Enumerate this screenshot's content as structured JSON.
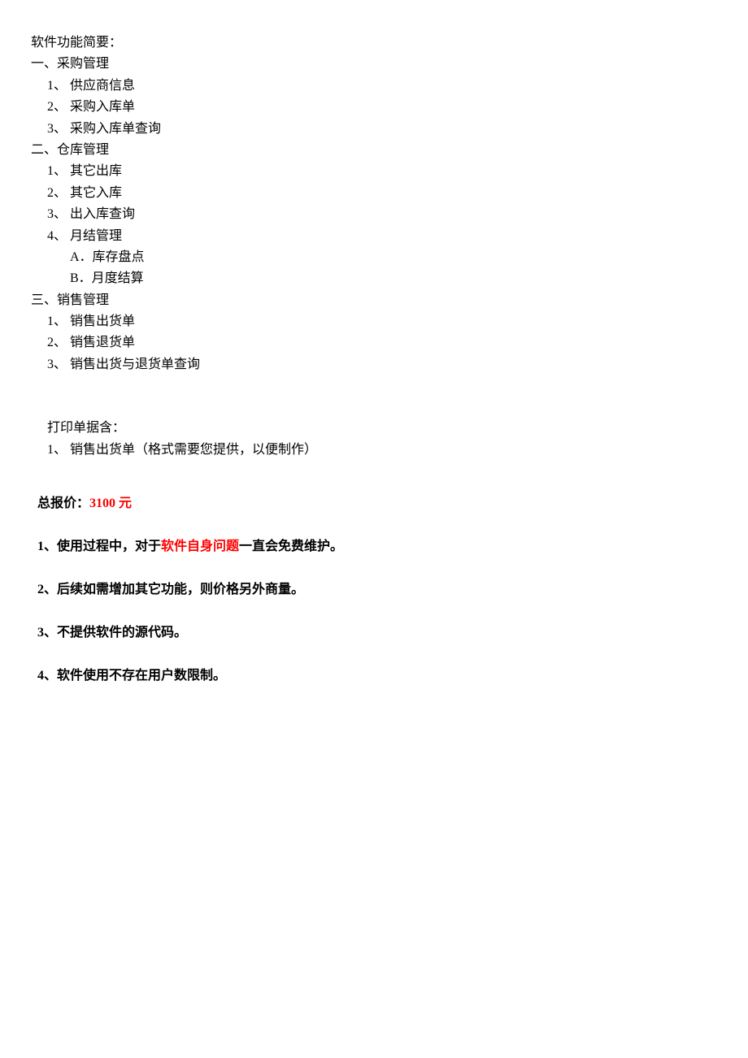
{
  "title": "软件功能简要：",
  "sections": [
    {
      "heading": "一、采购管理",
      "items": [
        "1、 供应商信息",
        "2、 采购入库单",
        "3、 采购入库单查询"
      ]
    },
    {
      "heading": "二、仓库管理",
      "items": [
        "1、 其它出库",
        "2、 其它入库",
        "3、 出入库查询",
        "4、 月结管理"
      ],
      "subitems": [
        "A．库存盘点",
        "B．月度结算"
      ]
    },
    {
      "heading": "三、销售管理",
      "items": [
        "1、 销售出货单",
        "2、 销售退货单",
        "3、 销售出货与退货单查询"
      ]
    }
  ],
  "print_heading": "打印单据含：",
  "print_items": [
    "1、 销售出货单（格式需要您提供，以便制作）"
  ],
  "price_label": "总报价：",
  "price_value": "3100 元",
  "notes": [
    {
      "prefix": "1、使用过程中，对于",
      "red": "软件自身问题",
      "suffix": "一直会免费维护。"
    },
    {
      "prefix": "2、后续如需增加其它功能，则价格另外商量。",
      "red": "",
      "suffix": ""
    },
    {
      "prefix": "3、不提供软件的源代码。",
      "red": "",
      "suffix": ""
    },
    {
      "prefix": "4、软件使用不存在用户数限制。",
      "red": "",
      "suffix": ""
    }
  ]
}
